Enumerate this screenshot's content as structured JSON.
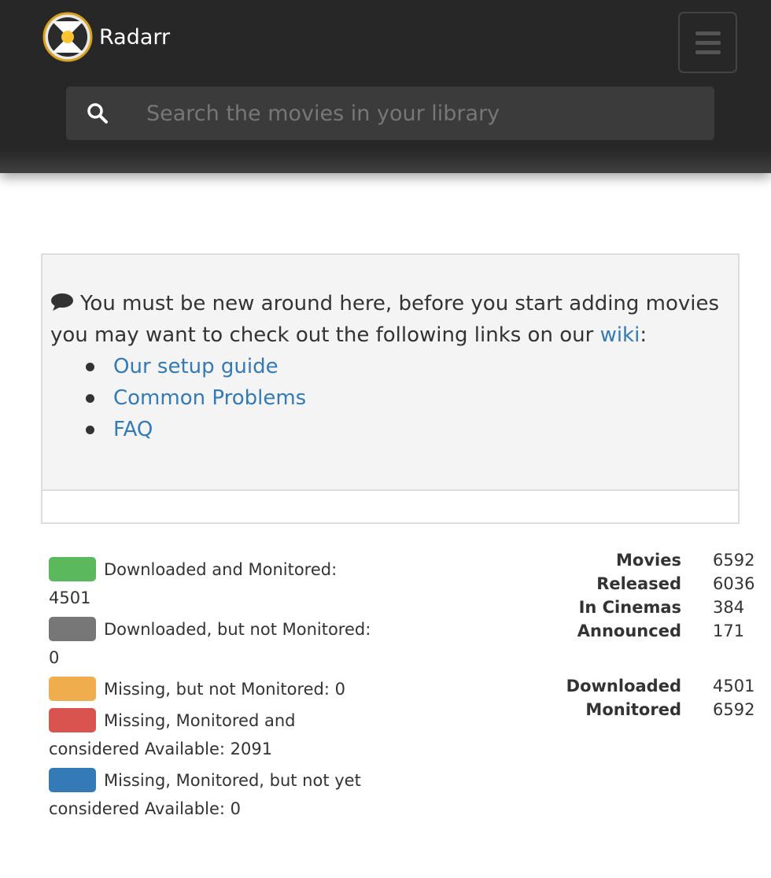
{
  "header": {
    "brand_name": "Radarr",
    "logo_icon": "radarr-logo-icon",
    "menu_icon": "hamburger-menu-icon",
    "search": {
      "icon": "search-icon",
      "placeholder": "Search the movies in your library",
      "value": ""
    }
  },
  "welcome_panel": {
    "icon": "chat-bubble-icon",
    "intro_text": "You must be new around here, before you start adding movies you may want to check out the following links on our",
    "wiki_link": "wiki",
    "intro_suffix": ":",
    "links": [
      {
        "label": "Our setup guide"
      },
      {
        "label": "Common Problems"
      },
      {
        "label": "FAQ"
      }
    ]
  },
  "legend": [
    {
      "label": "Downloaded and Monitored: 4501",
      "color": "#5cb85c"
    },
    {
      "label": "Downloaded, but not Monitored: 0",
      "color": "#777777"
    },
    {
      "label": "Missing, but not Monitored: 0",
      "color": "#f0ad4e"
    },
    {
      "label": "Missing, Monitored and considered Available: 2091",
      "color": "#d9534f"
    },
    {
      "label": "Missing, Monitored, but not yet considered Available: 0",
      "color": "#337ab7"
    }
  ],
  "stats": {
    "group1": [
      {
        "label": "Movies",
        "value": "6592"
      },
      {
        "label": "Released",
        "value": "6036"
      },
      {
        "label": "In Cinemas",
        "value": "384"
      },
      {
        "label": "Announced",
        "value": "171"
      }
    ],
    "group2": [
      {
        "label": "Downloaded",
        "value": "4501"
      },
      {
        "label": "Monitored",
        "value": "6592"
      }
    ]
  }
}
